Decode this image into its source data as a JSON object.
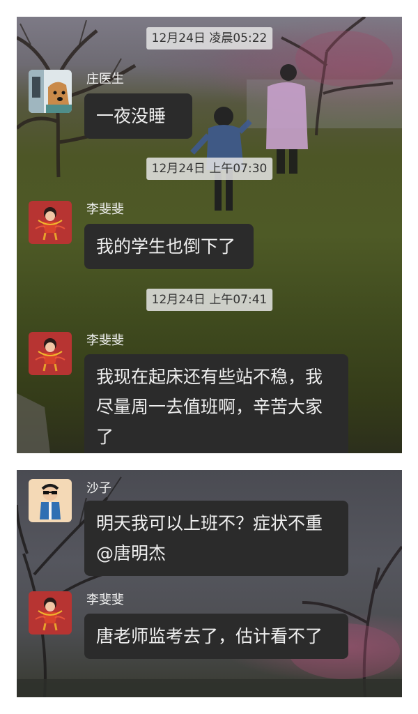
{
  "screenshot_1": {
    "messages": [
      {
        "timestamp": "12月24日 凌晨05:22",
        "sender": "庄医生",
        "text": "一夜没睡",
        "avatar_icon": "doctor-with-dog-photo"
      },
      {
        "timestamp": "12月24日 上午07:30",
        "sender": "李斐斐",
        "text": "我的学生也倒下了",
        "avatar_icon": "red-cartoon-nezha-figure"
      },
      {
        "timestamp": "12月24日 上午07:41",
        "sender": "李斐斐",
        "text": "我现在起床还有些站不稳，我尽量周一去值班啊，辛苦大家了",
        "avatar_icon": "red-cartoon-nezha-figure"
      }
    ]
  },
  "screenshot_2": {
    "messages": [
      {
        "sender": "沙子",
        "text": "明天我可以上班不？症状不重@唐明杰",
        "avatar_icon": "cartoon-boy-sunglasses"
      },
      {
        "sender": "李斐斐",
        "text": "唐老师监考去了，估计看不了",
        "avatar_icon": "red-cartoon-nezha-figure"
      }
    ]
  },
  "colors": {
    "bubble_bg": "#2b2b2b",
    "bubble_text": "#efefef",
    "timestamp_bg": "#e4e4e4",
    "timestamp_text": "#333333",
    "sender_text": "#f2f2f2",
    "page_bg": "#ffffff"
  }
}
